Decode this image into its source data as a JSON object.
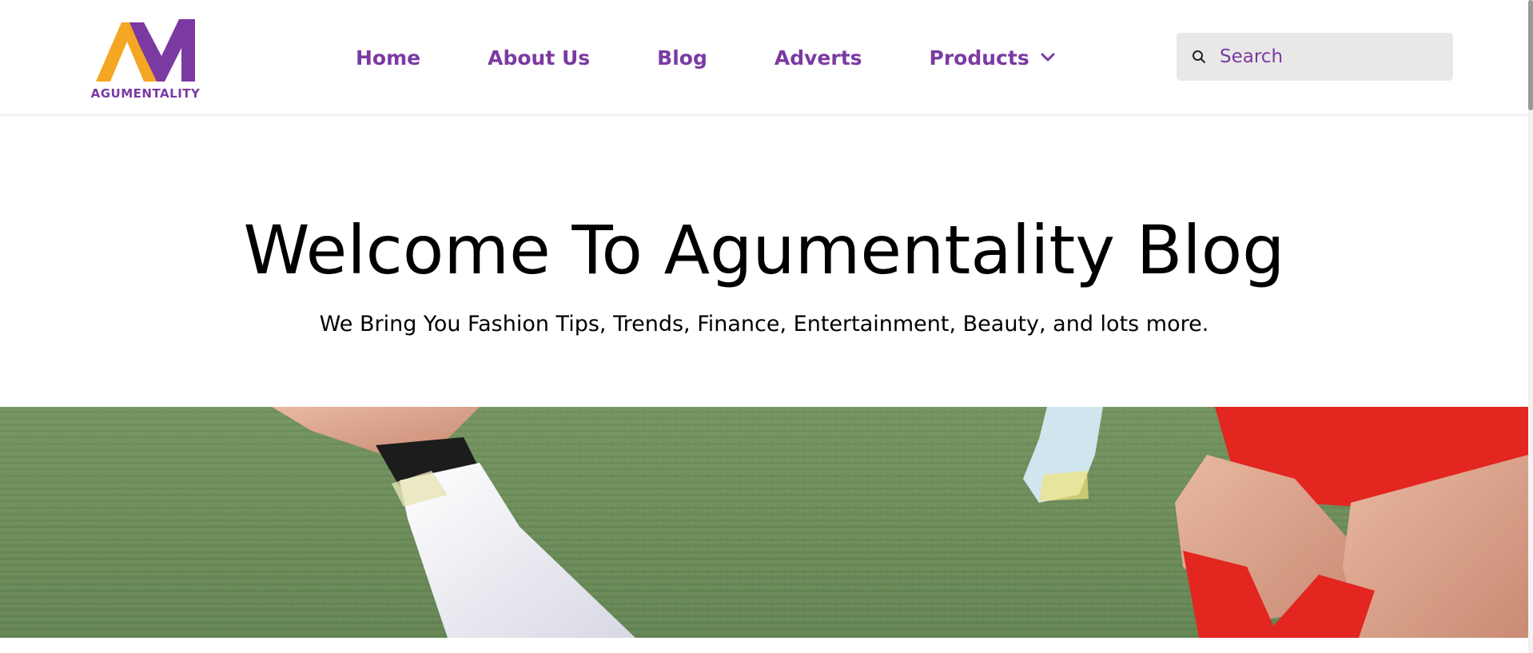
{
  "header": {
    "logo": {
      "text": "AGUMENTALITY",
      "icon": "am-monogram-logo"
    },
    "nav": [
      {
        "label": "Home"
      },
      {
        "label": "About Us"
      },
      {
        "label": "Blog"
      },
      {
        "label": "Adverts"
      },
      {
        "label": "Products",
        "icon": "chevron-down-icon"
      }
    ],
    "search": {
      "placeholder": "Search",
      "value": "",
      "icon": "search-icon"
    }
  },
  "hero": {
    "title": "Welcome To Agumentality Blog",
    "subtitle": "We Bring You Fashion Tips, Trends, Finance, Entertainment, Beauty, and lots more.",
    "image": "soccer-players-on-grass-photo"
  },
  "colors": {
    "brand_purple": "#7b3aa2",
    "brand_orange": "#f5a623",
    "text_dark": "#000000",
    "search_bg": "#e8e8e8",
    "grass": "#6f8f5a",
    "red_kit": "#e32620"
  }
}
